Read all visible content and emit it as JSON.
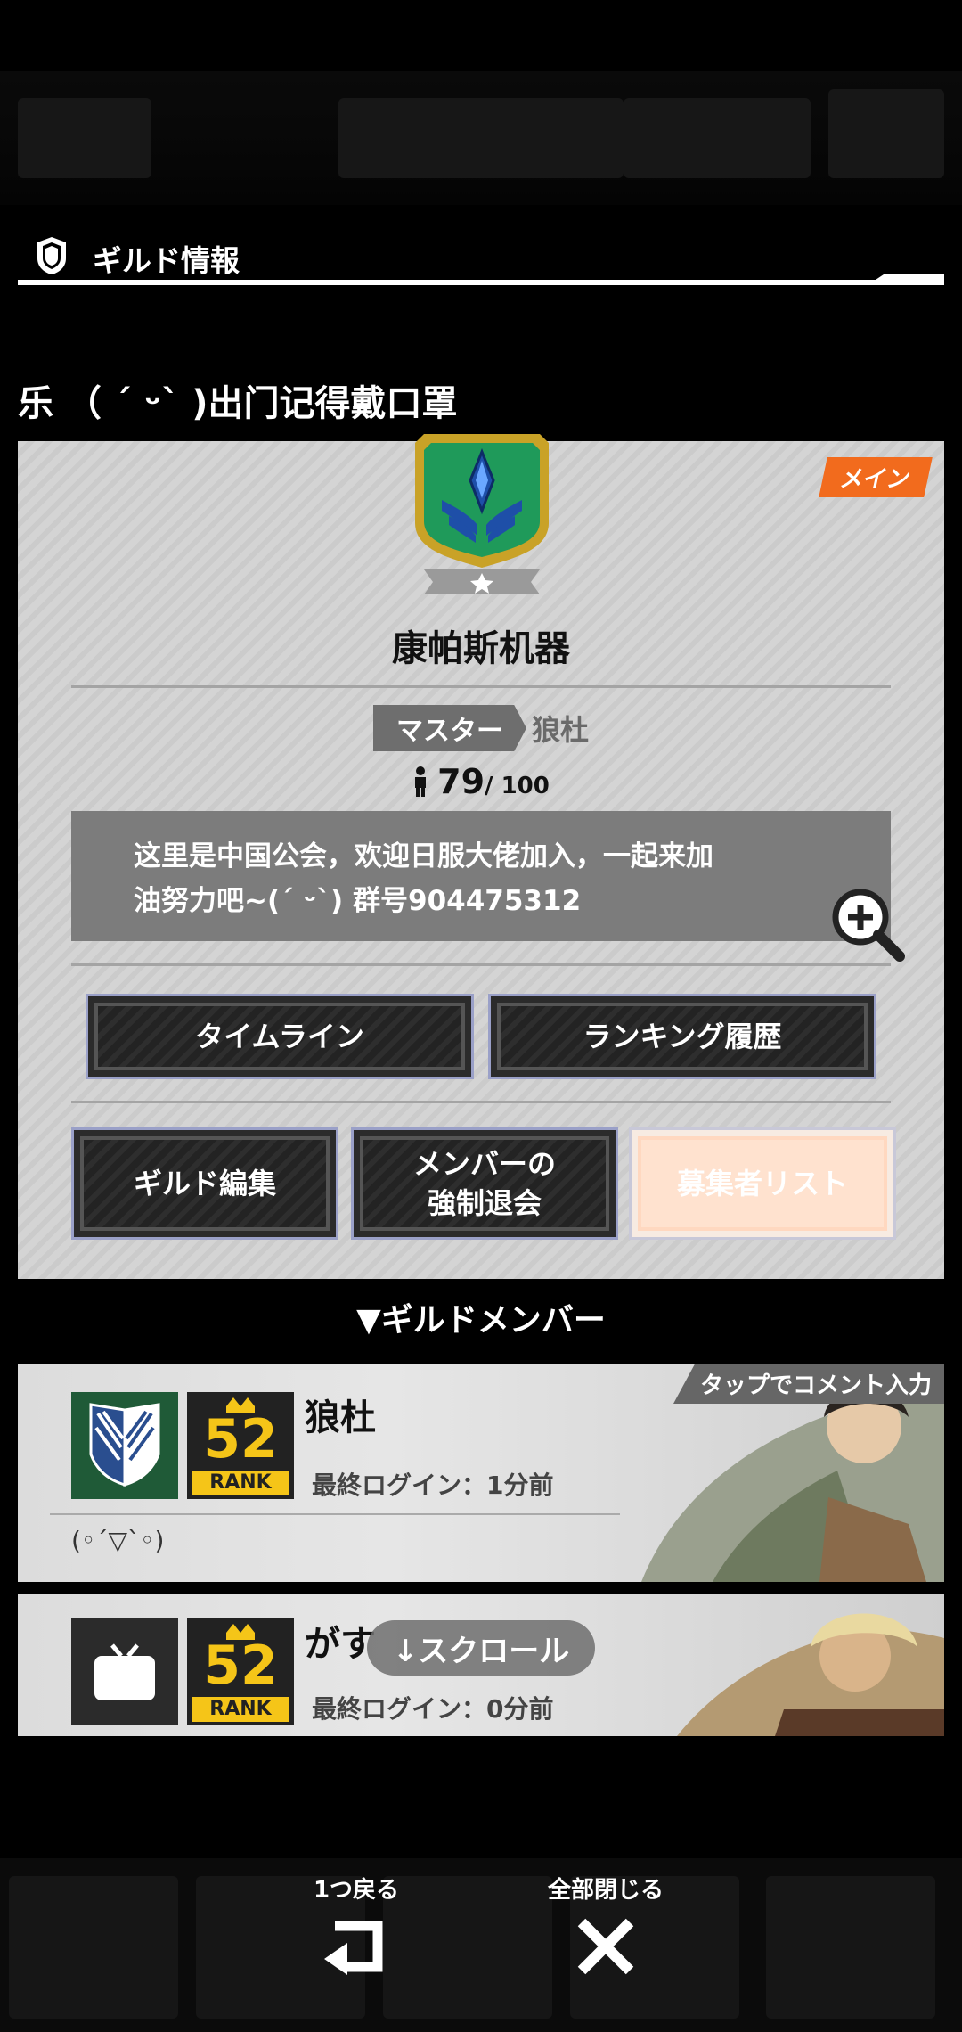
{
  "header": {
    "title": "ギルド情報"
  },
  "guild": {
    "caption": "乐 （ ˊ ᵕˋ )出门记得戴口罩",
    "tag": "メイン",
    "name": "康帕斯机器",
    "master_label": "マスター",
    "master_name": "狼杜",
    "member_count": "79",
    "member_max": "/ 100",
    "description_line1": "这里是中国公会，欢迎日服大佬加入，一起来加",
    "description_line2": "油努力吧~(ˊ ᵕˋ) 群号904475312"
  },
  "buttons": {
    "timeline": "タイムライン",
    "ranking_history": "ランキング履歴",
    "guild_edit": "ギルド編集",
    "kick_member_line1": "メンバーの",
    "kick_member_line2": "強制退会",
    "applicant_list": "募集者リスト"
  },
  "members_section": {
    "title": "▼ギルドメンバー"
  },
  "members": [
    {
      "name": "狼杜",
      "rank": "52",
      "rank_label": "RANK",
      "last_login": "最終ログイン：1分前",
      "comment": "(◦ˊ▽ˋ◦)",
      "tag": "タップでコメント入力"
    },
    {
      "name": "がす",
      "rank": "52",
      "rank_label": "RANK",
      "last_login": "最終ログイン：0分前"
    }
  ],
  "scroll_hint": "↓スクロール",
  "footer": {
    "back_label": "1つ戻る",
    "close_all_label": "全部閉じる"
  },
  "colors": {
    "accent": "#f26b1d",
    "emblem_green": "#1f9a5a",
    "emblem_gold": "#c9a227",
    "rank_gold": "#f5c518"
  }
}
